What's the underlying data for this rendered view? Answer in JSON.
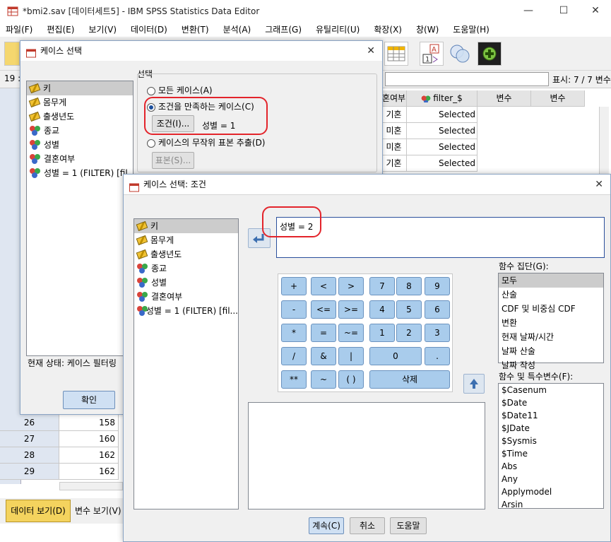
{
  "window": {
    "title": "*bmi2.sav [데이터세트5] - IBM SPSS Statistics Data Editor",
    "min": "—",
    "max": "☐",
    "close": "✕"
  },
  "menu": [
    "파일(F)",
    "편집(E)",
    "보기(V)",
    "데이터(D)",
    "변환(T)",
    "분석(A)",
    "그래프(G)",
    "유틸리티(U)",
    "확장(X)",
    "창(W)",
    "도움말(H)"
  ],
  "cellbar": {
    "cell_ref": "19 :",
    "display": "표시: 7 / 7 변수"
  },
  "grid": {
    "headers": [
      "혼여부",
      "filter_$",
      "변수",
      "변수"
    ],
    "top_rows": [
      {
        "c1": "기혼",
        "c2": "Selected"
      },
      {
        "c1": "미혼",
        "c2": "Selected"
      },
      {
        "c1": "미혼",
        "c2": "Selected"
      },
      {
        "c1": "기혼",
        "c2": "Selected"
      }
    ],
    "bottom_rows": [
      {
        "num": "26",
        "val": "158"
      },
      {
        "num": "27",
        "val": "160"
      },
      {
        "num": "28",
        "val": "162"
      },
      {
        "num": "29",
        "val": "162"
      }
    ]
  },
  "view_tabs": {
    "data": "데이터 보기(D)",
    "variable": "변수 보기(V)"
  },
  "dialog1": {
    "title": "케이스 선택",
    "variables": [
      "키",
      "몸무게",
      "출생년도",
      "종교",
      "성별",
      "결혼여부",
      "성별 = 1 (FILTER) [fil"
    ],
    "group_label": "선택",
    "opt_all": "모든 케이스(A)",
    "opt_cond": "조건을 만족하는 케이스(C)",
    "cond_button": "조건(I)...",
    "cond_text": "성별 = 1",
    "opt_random": "케이스의 무작위 표본 추출(D)",
    "sample_button": "표본(S)...",
    "status": "현재 상태: 케이스 필터링",
    "ok": "확인"
  },
  "dialog2": {
    "title": "케이스 선택: 조건",
    "variables": [
      "키",
      "몸무게",
      "출생년도",
      "종교",
      "성별",
      "결혼여부",
      "성별 = 1 (FILTER) [fil..."
    ],
    "expression": "성별 = 2",
    "keypad": [
      "+",
      "<",
      ">",
      "7",
      "8",
      "9",
      "-",
      "<=",
      ">=",
      "4",
      "5",
      "6",
      "*",
      "=",
      "~=",
      "1",
      "2",
      "3",
      "/",
      "&",
      "|",
      "0",
      ".",
      "**",
      "~",
      "( )",
      "삭제"
    ],
    "func_group_label": "함수 집단(G):",
    "func_groups": [
      "모두",
      "산술",
      "CDF 및 비중심 CDF",
      "변환",
      "현재 날짜/시간",
      "날짜 산술",
      "날짜 작성"
    ],
    "func_label": "함수 및 특수변수(F):",
    "functions": [
      "$Casenum",
      "$Date",
      "$Date11",
      "$JDate",
      "$Sysmis",
      "$Time",
      "Abs",
      "Any",
      "Applymodel",
      "Arsin"
    ],
    "continue": "계속(C)",
    "cancel": "취소",
    "help": "도움말"
  },
  "colors": {
    "accent": "#a9ccec",
    "highlight": "#e3242b"
  }
}
